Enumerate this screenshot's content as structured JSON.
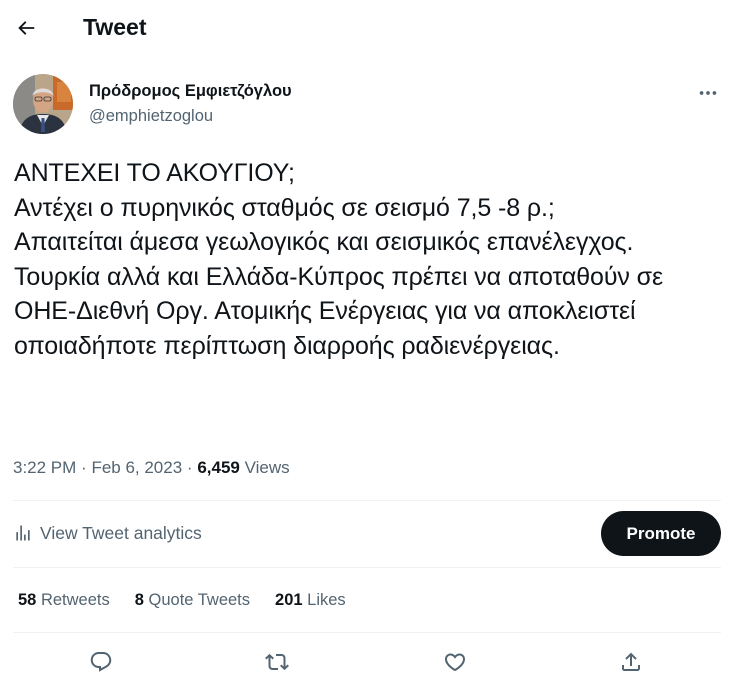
{
  "header": {
    "title": "Tweet"
  },
  "author": {
    "name": "Πρόδρομος Εμφιετζόγλου",
    "handle": "@emphietzoglou"
  },
  "tweet": {
    "text": "ΑΝΤΕΧΕΙ ΤΟ ΑΚΟΥΓΙΟΥ;\nΑντέχει ο πυρηνικός σταθμός σε σεισμό 7,5 -8 ρ.;\nΑπαιτείται άμεσα γεωλογικός και σεισμικός επανέλεγχος.\nΤουρκία αλλά και  Ελλάδα-Κύπρος πρέπει να αποταθούν σε ΟΗΕ-Διεθνή Οργ. Ατομικής Ενέργειας για να αποκλειστεί οποιαδήποτε περίπτωση διαρροής ραδιενέργειας."
  },
  "meta": {
    "time": "3:22 PM",
    "date": "Feb 6, 2023",
    "views_count": "6,459",
    "views_label": "Views"
  },
  "analytics": {
    "label": "View Tweet analytics"
  },
  "promote": {
    "label": "Promote"
  },
  "stats": {
    "retweets_count": "58",
    "retweets_label": "Retweets",
    "quotes_count": "8",
    "quotes_label": "Quote Tweets",
    "likes_count": "201",
    "likes_label": "Likes"
  },
  "icons": {
    "back": "arrow-left-icon",
    "more": "more-horizontal-icon",
    "analytics": "bar-chart-icon",
    "reply": "reply-icon",
    "retweet": "retweet-icon",
    "like": "heart-icon",
    "share": "share-icon"
  },
  "colors": {
    "text": "#0f1419",
    "secondary": "#536471",
    "divider": "#eff3f4",
    "button": "#0f1419"
  }
}
